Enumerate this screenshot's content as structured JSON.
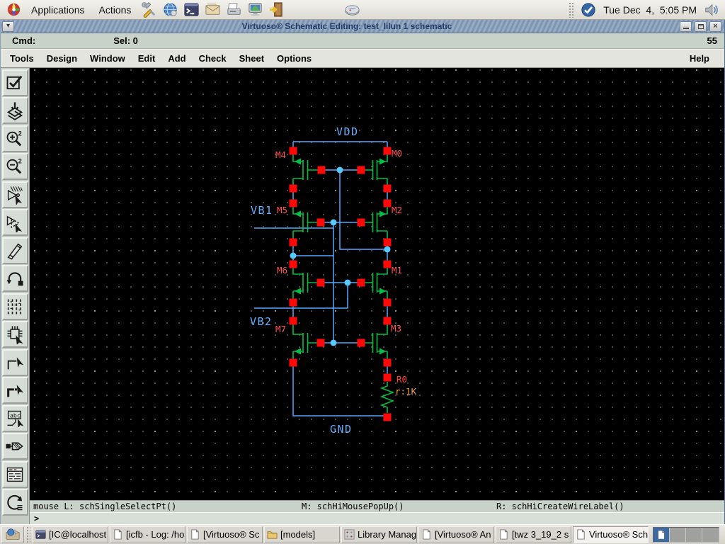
{
  "panel": {
    "applications_label": "Applications",
    "actions_label": "Actions",
    "clock": "Tue Dec  4,  5:05 PM",
    "launcher_icons": [
      "system-tools",
      "web-browser",
      "terminal",
      "email",
      "print-manager",
      "display",
      "logout",
      "scanner"
    ]
  },
  "window": {
    "title": "Virtuoso® Schematic Editing: test_lilun 1 schematic",
    "cmd_label": "Cmd:",
    "sel_label": "Sel: 0",
    "counter": "55",
    "menus": [
      "Tools",
      "Design",
      "Window",
      "Edit",
      "Add",
      "Check",
      "Sheet",
      "Options"
    ],
    "help_label": "Help",
    "bindings": {
      "left": "mouse L: schSingleSelectPt()",
      "middle": "M: schHiMousePopUp()",
      "right": "R: schHiCreateWireLabel()"
    },
    "prompt": ">"
  },
  "toolbar": {
    "items": [
      "check-and-save",
      "save",
      "zoom-in-2x",
      "zoom-out-2x",
      "stretch",
      "copy",
      "delete",
      "undo",
      "property",
      "instance",
      "wire-narrow",
      "wire-wide",
      "wire-label",
      "pin",
      "cmd-options",
      "repeat"
    ]
  },
  "schematic": {
    "net_labels": {
      "vdd": "VDD",
      "gnd": "GND",
      "vb1": "VB1",
      "vb2": "VB2"
    },
    "instance_labels": {
      "m4": "M4",
      "m0": "M0",
      "m5": "M5",
      "m2": "M2",
      "m6": "M6",
      "m1": "M1",
      "m7": "M7",
      "m3": "M3"
    },
    "resistor": {
      "name": "R0",
      "value": "r:1K"
    },
    "colors": {
      "wire": "#55A7FF",
      "device": "#00BE46",
      "terminal": "#FF0808",
      "solder_dot": "#58C9FF",
      "instance_label": "#FF5555",
      "net_label": "#61AFFF",
      "value_label": "#F0A030",
      "background": "#000000",
      "titlebar": "#8299B5"
    }
  },
  "taskbar": {
    "buttons": [
      {
        "icon": "terminal",
        "label": "[IC@localhost"
      },
      {
        "icon": "file",
        "label": "[icfb - Log: /ho"
      },
      {
        "icon": "file",
        "label": "[Virtuoso® Sc"
      },
      {
        "icon": "folder",
        "label": "[models]"
      },
      {
        "icon": "library",
        "label": "Library Manag"
      },
      {
        "icon": "file",
        "label": "[Virtuoso® An"
      },
      {
        "icon": "file",
        "label": "[twz 3_19_2 s"
      },
      {
        "icon": "file",
        "label": "Virtuoso® Sch"
      }
    ],
    "workspace_count": "4"
  }
}
